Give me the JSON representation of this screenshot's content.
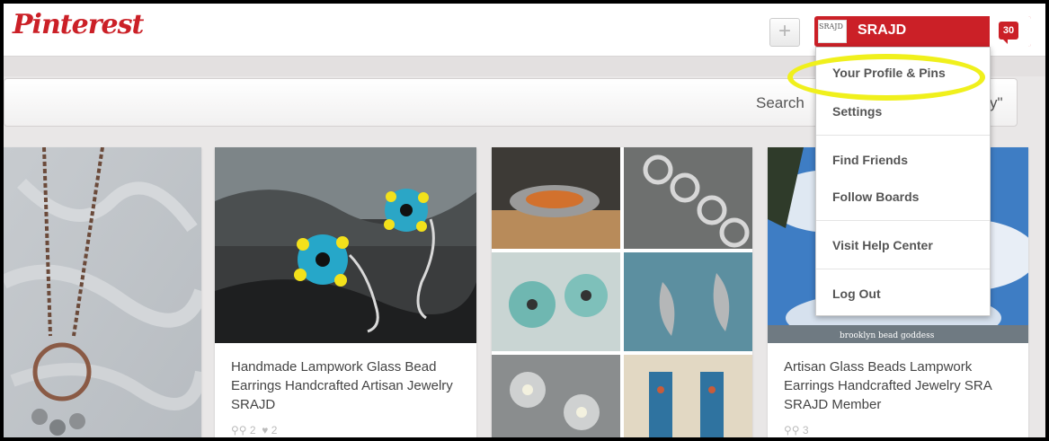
{
  "header": {
    "logo": "Pinterest",
    "add_button_label": "+",
    "user_name": "SRAJD",
    "avatar_text": "SRAJD",
    "notification_count": "30"
  },
  "search": {
    "text": "Search",
    "trailing_text": "y\""
  },
  "dropdown": {
    "items": [
      {
        "label": "Your Profile & Pins"
      },
      {
        "label": "Settings"
      },
      {
        "label": "Find Friends"
      },
      {
        "label": "Follow Boards"
      },
      {
        "label": "Visit Help Center"
      },
      {
        "label": "Log Out"
      }
    ]
  },
  "pins": [
    {
      "description": "",
      "stats": ""
    },
    {
      "description": "Handmade Lampwork Glass Bead Earrings Handcrafted Artisan Jewelry SRAJD",
      "repins": "2",
      "likes": "2"
    },
    {
      "description": "",
      "stats": ""
    },
    {
      "description": "Artisan Glass Beads Lampwork Earrings Handcrafted Jewelry SRA SRAJD Member",
      "repins": "3",
      "image_caption": "brooklyn bead goddess"
    }
  ],
  "colors": {
    "brand_red": "#cb2027",
    "highlight_yellow": "#f0f01c"
  }
}
